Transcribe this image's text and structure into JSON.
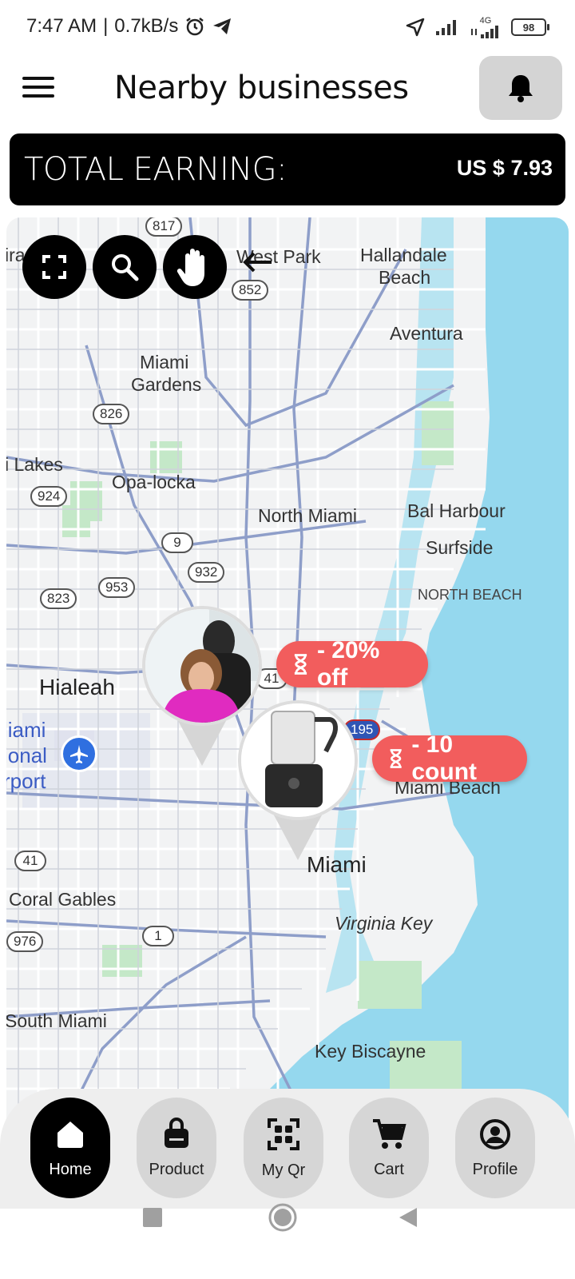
{
  "status_bar": {
    "time": "7:47 AM",
    "speed": "0.7kB/s",
    "network": "4G",
    "battery": "98",
    "icons": [
      "alarm-icon",
      "telegram-icon",
      "location-icon",
      "signal-icon",
      "battery-icon"
    ]
  },
  "header": {
    "title": "Nearby businesses",
    "menu_icon": "hamburger-menu-icon",
    "notification_icon": "bell-icon"
  },
  "earning": {
    "label": "TOTAL EARNING:",
    "value": "US $ 7.93"
  },
  "map": {
    "controls": [
      "fullscreen-icon",
      "search-icon",
      "hand-icon"
    ],
    "labels": {
      "west_park": "West Park",
      "hallandale": "Hallandale",
      "beach": "Beach",
      "aventura": "Aventura",
      "miami_gardens_1": "Miami",
      "miami_gardens_2": "Gardens",
      "lakes": "i Lakes",
      "opa_locka": "Opa-locka",
      "north_miami": "North Miami",
      "bal_harbour": "Bal Harbour",
      "surfside": "Surfside",
      "north_beach": "NORTH BEACH",
      "hialeah": "Hialeah",
      "airport_1": "liami",
      "airport_2": "ional",
      "airport_3": "rport",
      "miami_beach": "Miami Beach",
      "miami": "Miami",
      "coral_gables": "Coral Gables",
      "virginia_key": "Virginia Key",
      "south_miami": "South Miami",
      "key_biscayne": "Key Biscayne",
      "edge_ira": "ira"
    },
    "shields": {
      "r817": "817",
      "r852": "852",
      "r826": "826",
      "r924": "924",
      "r9": "9",
      "r932": "932",
      "r953": "953",
      "r823": "823",
      "r41a": "41",
      "r195": "195",
      "r41b": "41",
      "r1": "1",
      "r976": "976"
    },
    "offers": [
      {
        "text": "- 20% off",
        "icon": "hourglass-icon"
      },
      {
        "text": "- 10 count",
        "icon": "hourglass-icon"
      }
    ]
  },
  "bottom_nav": {
    "items": [
      {
        "label": "Home",
        "icon": "home-icon",
        "active": true
      },
      {
        "label": "Product",
        "icon": "bag-icon",
        "active": false
      },
      {
        "label": "My Qr",
        "icon": "qr-scan-icon",
        "active": false
      },
      {
        "label": "Cart",
        "icon": "cart-icon",
        "active": false
      },
      {
        "label": "Profile",
        "icon": "profile-icon",
        "active": false
      }
    ]
  },
  "colors": {
    "banner_bg": "#000000",
    "offer_badge": "#f25d5d",
    "water": "#95d8ee",
    "map_land": "#f2f3f4",
    "nav_pill": "#d6d6d6"
  }
}
